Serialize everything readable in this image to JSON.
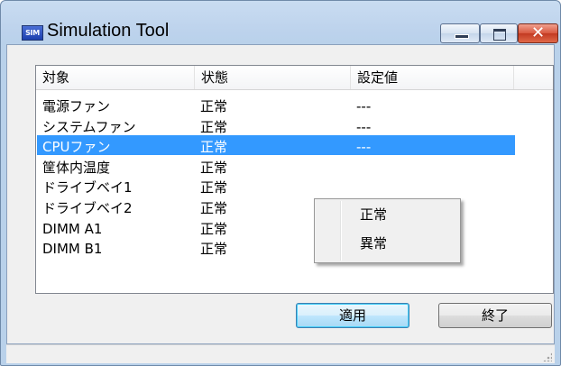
{
  "window": {
    "icon_text": "SIM",
    "title": "Simulation Tool",
    "close_glyph": "✕"
  },
  "list": {
    "columns": [
      "対象",
      "状態",
      "設定値"
    ],
    "rows": [
      {
        "target": "電源ファン",
        "status": "正常",
        "value": "---",
        "selected": false
      },
      {
        "target": "システムファン",
        "status": "正常",
        "value": "---",
        "selected": false
      },
      {
        "target": "CPUファン",
        "status": "正常",
        "value": "---",
        "selected": true
      },
      {
        "target": "筐体内温度",
        "status": "正常",
        "value": "",
        "selected": false
      },
      {
        "target": "ドライブベイ1",
        "status": "正常",
        "value": "",
        "selected": false
      },
      {
        "target": "ドライブベイ2",
        "status": "正常",
        "value": "",
        "selected": false
      },
      {
        "target": "DIMM A1",
        "status": "正常",
        "value": "---",
        "selected": false
      },
      {
        "target": "DIMM B1",
        "status": "正常",
        "value": "---",
        "selected": false
      }
    ]
  },
  "context_menu": {
    "items": [
      "正常",
      "異常"
    ]
  },
  "buttons": {
    "apply_label": "適用",
    "exit_label": "終了"
  },
  "colors": {
    "selection": "#3399ff",
    "title_gradient": "#c9dcf1",
    "close_button": "#c23a22"
  }
}
